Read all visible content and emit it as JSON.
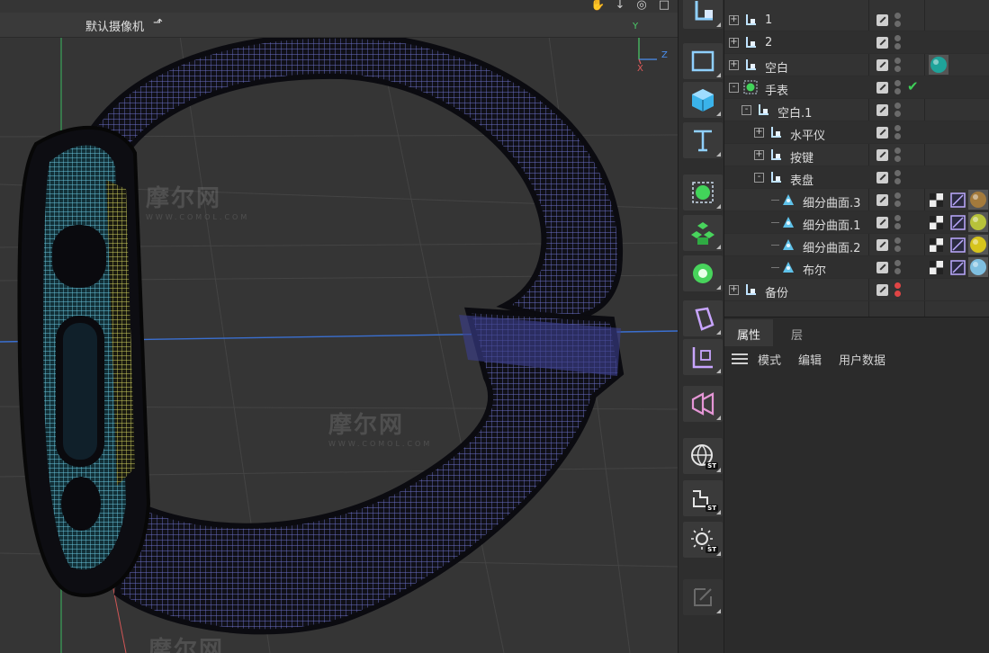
{
  "viewport": {
    "camera_label": "默认摄像机",
    "camera_icon": "camera-icon",
    "nav_icons": [
      "hand-icon",
      "arrow-down-icon",
      "orbit-icon",
      "maximize-icon"
    ],
    "axis": {
      "y": "Y",
      "z": "Z",
      "x": "X"
    },
    "watermarks": [
      {
        "title": "摩尔网",
        "sub": "WWW.COMOL.COM"
      },
      {
        "title": "摩尔网",
        "sub": "WWW.COMOL.COM"
      },
      {
        "title": "摩尔网",
        "sub": ""
      },
      {
        "title": "摩",
        "sub": ""
      }
    ]
  },
  "palette": {
    "tools": [
      "null-object-icon",
      "rectangle-spline-icon",
      "cube-icon",
      "text-spline-icon",
      "subdivision-surface-icon",
      "cloner-icon",
      "bend-deformer-icon",
      "extrude-icon",
      "coordinate-system-icon",
      "volume-icon",
      "sky-st-icon",
      "camera-st-icon",
      "light-st-icon",
      "sketch-icon"
    ],
    "badge": "ST"
  },
  "objects": [
    {
      "name": "1",
      "depth": 0,
      "expander": "+",
      "icon": "null-object-icon",
      "dot": "gray",
      "tags": []
    },
    {
      "name": "2",
      "depth": 0,
      "expander": "+",
      "icon": "null-object-icon",
      "dot": "gray",
      "tags": []
    },
    {
      "name": "空白",
      "depth": 0,
      "expander": "+",
      "icon": "null-object-icon",
      "dot": "gray",
      "tags": [
        "material-teal"
      ]
    },
    {
      "name": "手表",
      "depth": 0,
      "expander": "-",
      "icon": "subdivision-surface-icon",
      "dot": "gray",
      "check": true,
      "tags": []
    },
    {
      "name": "空白.1",
      "depth": 1,
      "expander": "-",
      "icon": "null-object-icon",
      "dot": "gray",
      "tags": []
    },
    {
      "name": "水平仪",
      "depth": 2,
      "expander": "+",
      "icon": "null-object-icon",
      "dot": "gray",
      "tags": []
    },
    {
      "name": "按键",
      "depth": 2,
      "expander": "+",
      "icon": "null-object-icon",
      "dot": "gray",
      "tags": []
    },
    {
      "name": "表盘",
      "depth": 2,
      "expander": "-",
      "icon": "null-object-icon",
      "dot": "gray",
      "tags": []
    },
    {
      "name": "细分曲面.3",
      "depth": 3,
      "expander": "",
      "icon": "polygon-object-icon",
      "dot": "gray",
      "tags": [
        "checker",
        "phong",
        "material-bronze"
      ]
    },
    {
      "name": "细分曲面.1",
      "depth": 3,
      "expander": "",
      "icon": "polygon-object-icon",
      "dot": "gray",
      "tags": [
        "checker",
        "phong",
        "material-lime"
      ]
    },
    {
      "name": "细分曲面.2",
      "depth": 3,
      "expander": "",
      "icon": "polygon-object-icon",
      "dot": "gray",
      "tags": [
        "checker",
        "phong",
        "material-yellow"
      ]
    },
    {
      "name": "布尔",
      "depth": 3,
      "expander": "",
      "icon": "polygon-object-icon",
      "dot": "gray",
      "tags": [
        "checker",
        "phong",
        "material-sky"
      ]
    },
    {
      "name": "备份",
      "depth": 0,
      "expander": "+",
      "icon": "null-object-icon",
      "dot": "red",
      "tags": []
    }
  ],
  "colors": {
    "material-teal": "#1fa39a",
    "material-bronze": "#a37a3c",
    "material-lime": "#b7c23a",
    "material-yellow": "#d6c41d",
    "material-sky": "#7fbfe0",
    "check": "#3ecf58",
    "dot-red": "#e04545",
    "accent-blue": "#3a88ff"
  },
  "attributes": {
    "tabs": [
      "属性",
      "层"
    ],
    "active_tab": "属性",
    "menu": [
      "模式",
      "编辑",
      "用户数据"
    ],
    "menu_icon": "hamburger-icon"
  }
}
